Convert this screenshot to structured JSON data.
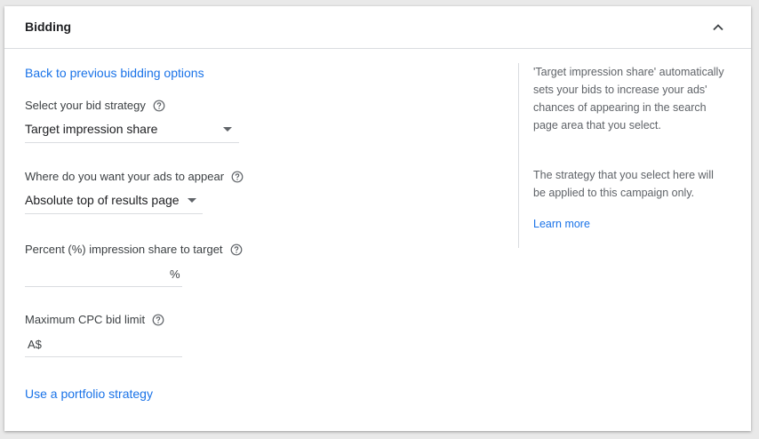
{
  "header": {
    "title": "Bidding"
  },
  "links": {
    "back": "Back to previous bidding options",
    "portfolio": "Use a portfolio strategy"
  },
  "bid_strategy": {
    "label": "Select your bid strategy",
    "value": "Target impression share"
  },
  "ad_location": {
    "label": "Where do you want your ads to appear",
    "value": "Absolute top of results page"
  },
  "impression_share": {
    "label": "Percent (%) impression share to target",
    "value": "",
    "suffix": "%"
  },
  "max_cpc": {
    "label": "Maximum CPC bid limit",
    "value": "",
    "prefix": "A$"
  },
  "side_panel": {
    "paragraph1": "'Target impression share' automatically sets your bids to increase your ads' chances of appearing in the search page area that you select.",
    "paragraph2": "The strategy that you select here will be applied to this campaign only.",
    "learn_more": "Learn more"
  },
  "colors": {
    "link": "#1a73e8",
    "text": "#202124",
    "secondary_text": "#5f6368",
    "divider": "#dadce0"
  },
  "icons": {
    "collapse": "chevron-up-icon",
    "help": "help-circle-icon",
    "dropdown": "caret-down-icon"
  }
}
